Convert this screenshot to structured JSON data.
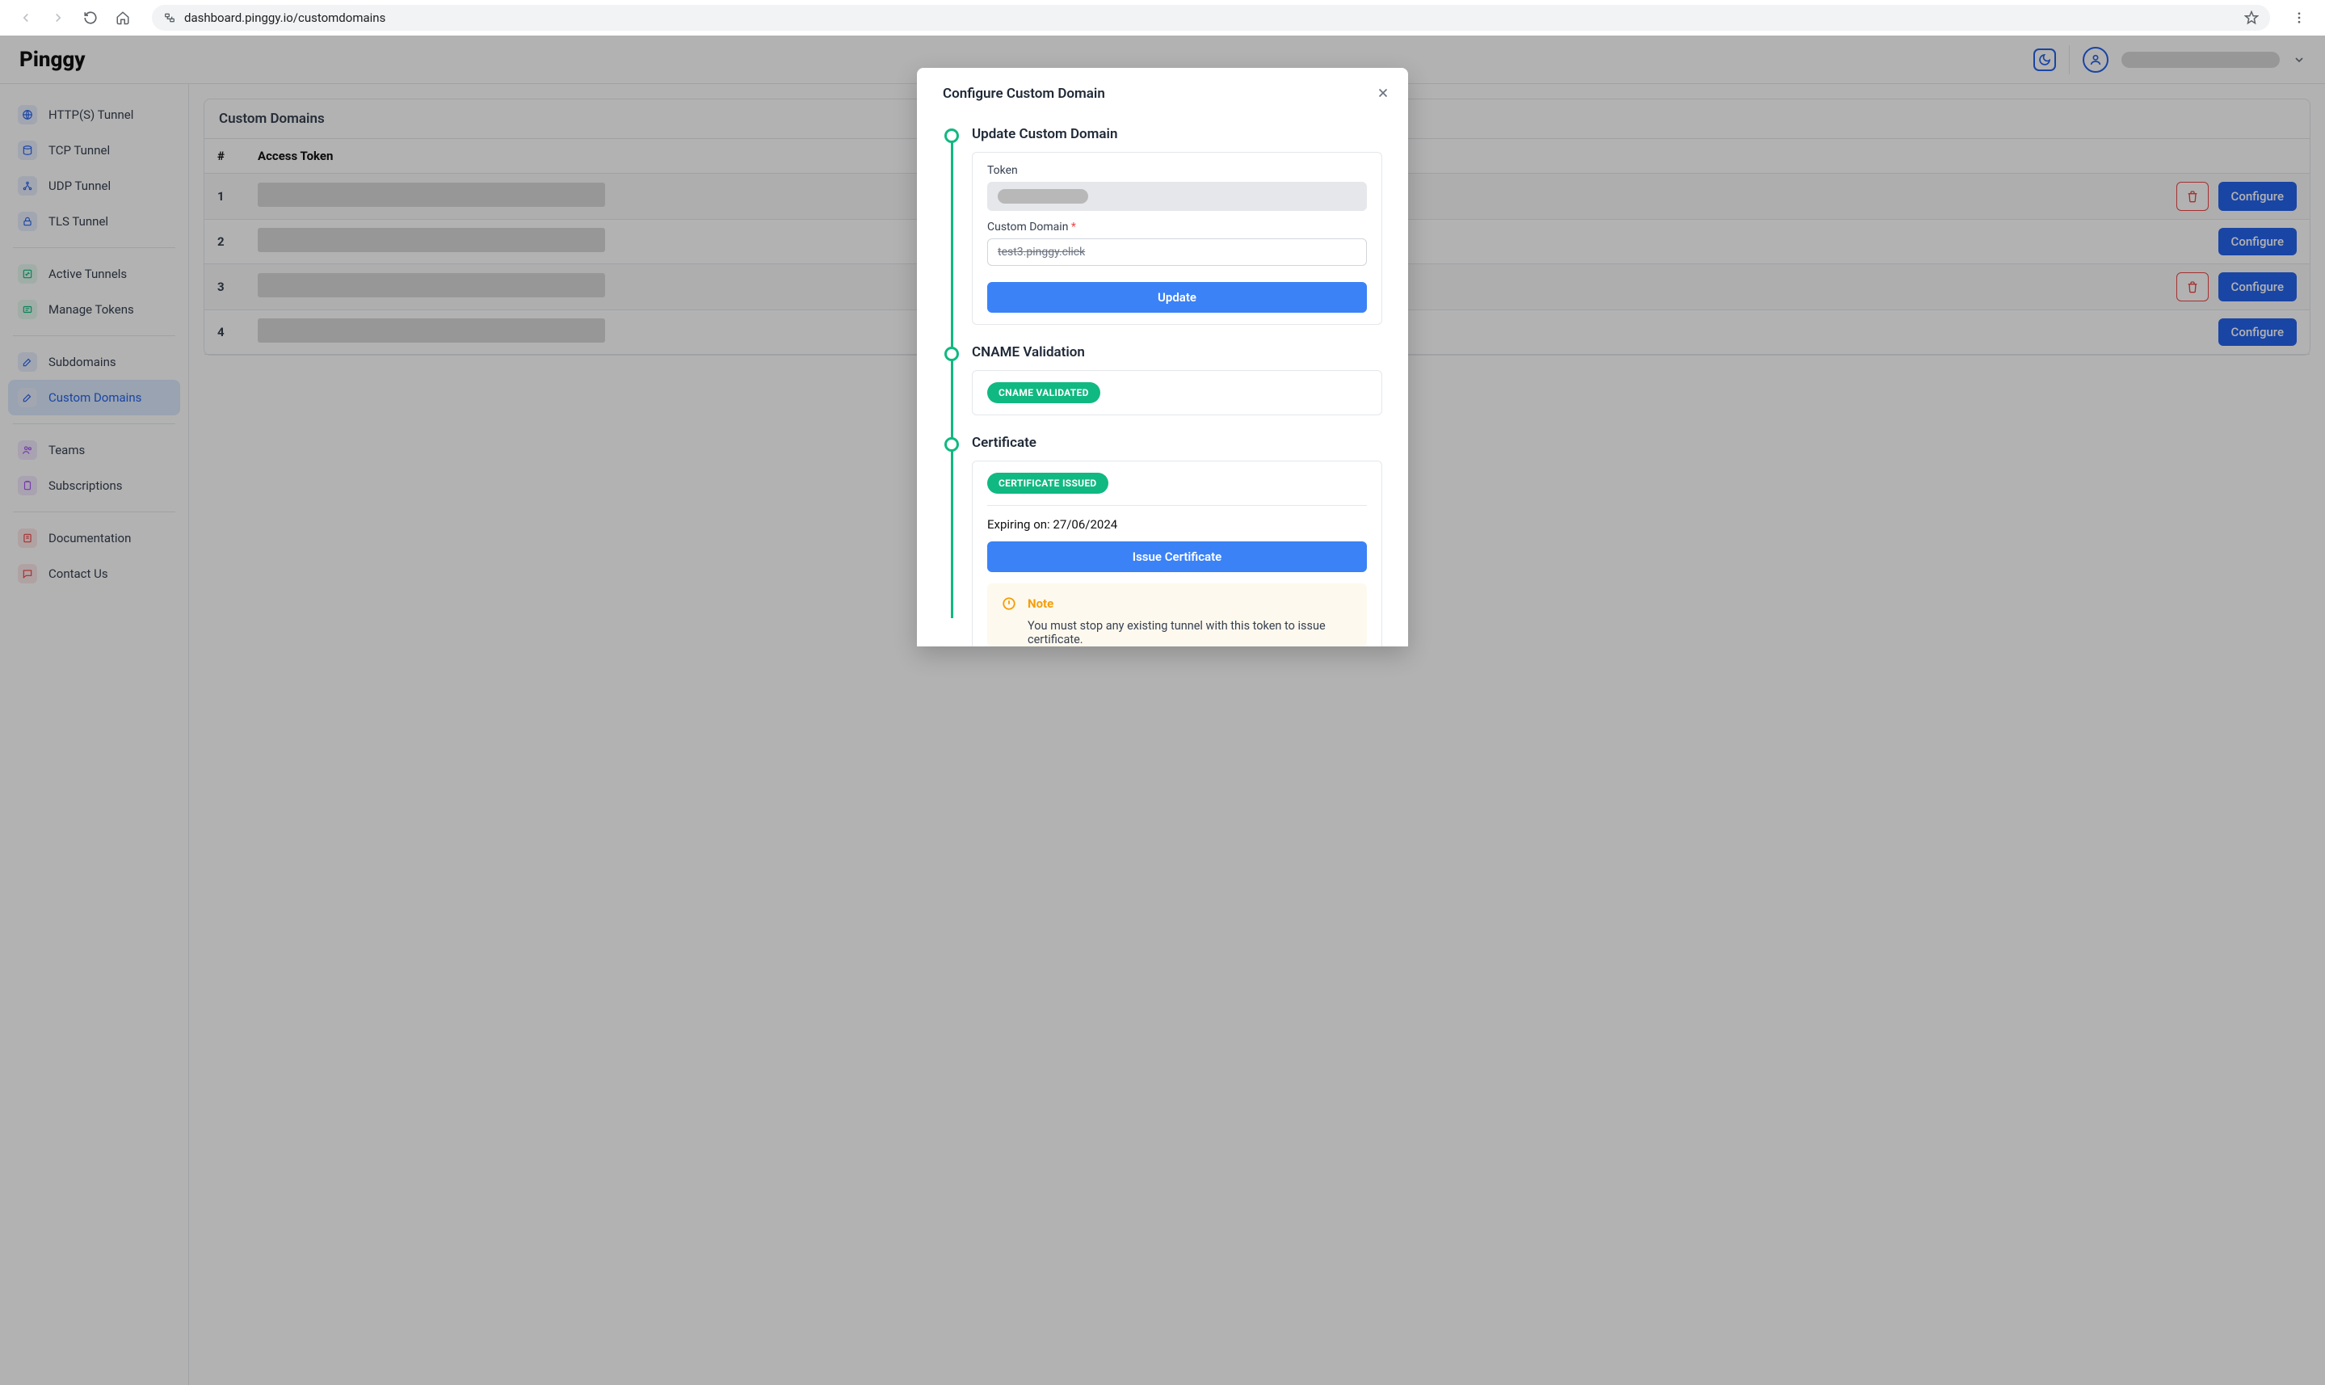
{
  "browser": {
    "url": "dashboard.pinggy.io/customdomains"
  },
  "brand": "Pinggy",
  "sidebar": {
    "groups": [
      {
        "items": [
          {
            "label": "HTTP(S) Tunnel"
          },
          {
            "label": "TCP Tunnel"
          },
          {
            "label": "UDP Tunnel"
          },
          {
            "label": "TLS Tunnel"
          }
        ]
      },
      {
        "items": [
          {
            "label": "Active Tunnels"
          },
          {
            "label": "Manage Tokens"
          }
        ]
      },
      {
        "items": [
          {
            "label": "Subdomains"
          },
          {
            "label": "Custom Domains",
            "active": true
          }
        ]
      },
      {
        "items": [
          {
            "label": "Teams"
          },
          {
            "label": "Subscriptions"
          }
        ]
      },
      {
        "items": [
          {
            "label": "Documentation"
          },
          {
            "label": "Contact Us"
          }
        ]
      }
    ]
  },
  "page": {
    "card_title": "Custom Domains",
    "columns": {
      "index": "#",
      "token": "Access Token"
    },
    "rows": [
      {
        "num": "1",
        "hasDelete": true
      },
      {
        "num": "2",
        "hasDelete": false
      },
      {
        "num": "3",
        "hasDelete": true
      },
      {
        "num": "4",
        "hasDelete": false
      }
    ],
    "configure_label": "Configure"
  },
  "modal": {
    "title": "Configure Custom Domain",
    "step1": {
      "title": "Update Custom Domain",
      "token_label": "Token",
      "domain_label": "Custom Domain",
      "domain_value": "test3.pinggy.click",
      "update_btn": "Update"
    },
    "step2": {
      "title": "CNAME Validation",
      "badge": "CNAME VALIDATED"
    },
    "step3": {
      "title": "Certificate",
      "badge": "CERTIFICATE ISSUED",
      "expiring": "Expiring on: 27/06/2024",
      "issue_btn": "Issue Certificate",
      "note_title": "Note",
      "note_body": "You must stop any existing tunnel with this token to issue certificate."
    }
  }
}
